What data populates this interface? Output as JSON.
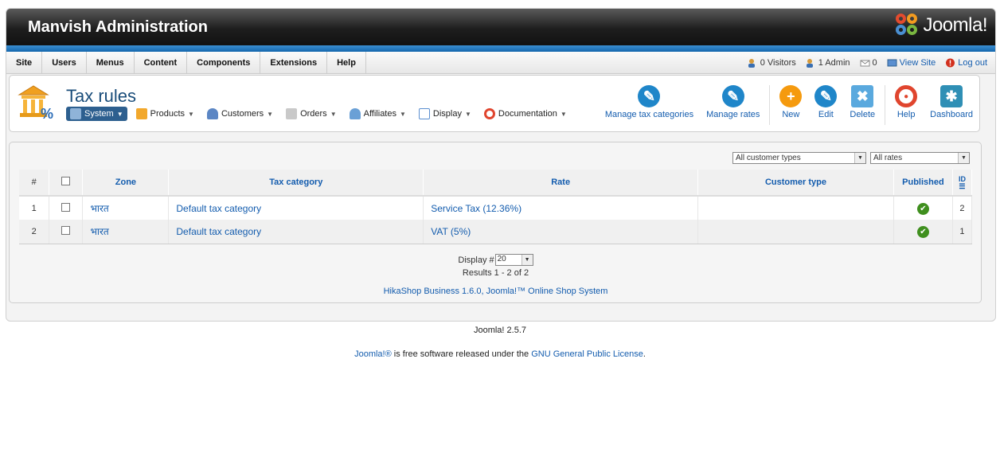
{
  "header": {
    "title": "Manvish Administration",
    "logo_text": "Joomla!"
  },
  "menu": [
    "Site",
    "Users",
    "Menus",
    "Content",
    "Components",
    "Extensions",
    "Help"
  ],
  "status": {
    "visitors": "0 Visitors",
    "admins": "1 Admin",
    "messages": "0",
    "view_site": "View Site",
    "logout": "Log out"
  },
  "page": {
    "title": "Tax rules"
  },
  "submenu": [
    {
      "label": "System",
      "icon": "wrench-icon",
      "active": true
    },
    {
      "label": "Products",
      "icon": "box-icon"
    },
    {
      "label": "Customers",
      "icon": "users-icon"
    },
    {
      "label": "Orders",
      "icon": "pen-icon"
    },
    {
      "label": "Affiliates",
      "icon": "users-icon"
    },
    {
      "label": "Display",
      "icon": "window-icon"
    },
    {
      "label": "Documentation",
      "icon": "lifebuoy-icon"
    }
  ],
  "toolbar": {
    "manage_tax_categories": "Manage tax categories",
    "manage_rates": "Manage rates",
    "new": "New",
    "edit": "Edit",
    "delete": "Delete",
    "help": "Help",
    "dashboard": "Dashboard"
  },
  "filters": {
    "customer_types": "All customer types",
    "rates": "All rates"
  },
  "table": {
    "columns": {
      "num": "#",
      "zone": "Zone",
      "tax_category": "Tax category",
      "rate": "Rate",
      "customer_type": "Customer type",
      "published": "Published",
      "id": "ID"
    },
    "rows": [
      {
        "num": "1",
        "zone": "भारत",
        "tax_category": "Default tax category",
        "rate": "Service Tax (12.36%)",
        "customer_type": "",
        "published": true,
        "id": "2"
      },
      {
        "num": "2",
        "zone": "भारत",
        "tax_category": "Default tax category",
        "rate": "VAT (5%)",
        "customer_type": "",
        "published": true,
        "id": "1"
      }
    ]
  },
  "pagination": {
    "display_label": "Display #",
    "display_value": "20",
    "results": "Results 1 - 2 of 2"
  },
  "credit": "HikaShop Business 1.6.0, Joomla!™ Online Shop System",
  "footer": {
    "version": "Joomla! 2.5.7",
    "license_link1": "Joomla!®",
    "license_text": " is free software released under the ",
    "license_link2": "GNU General Public License",
    "license_end": "."
  },
  "colors": {
    "link": "#135CAE",
    "header_dark": "#1e1e1e",
    "accent_blue": "#1467ad",
    "published_green": "#3f8f1e"
  }
}
